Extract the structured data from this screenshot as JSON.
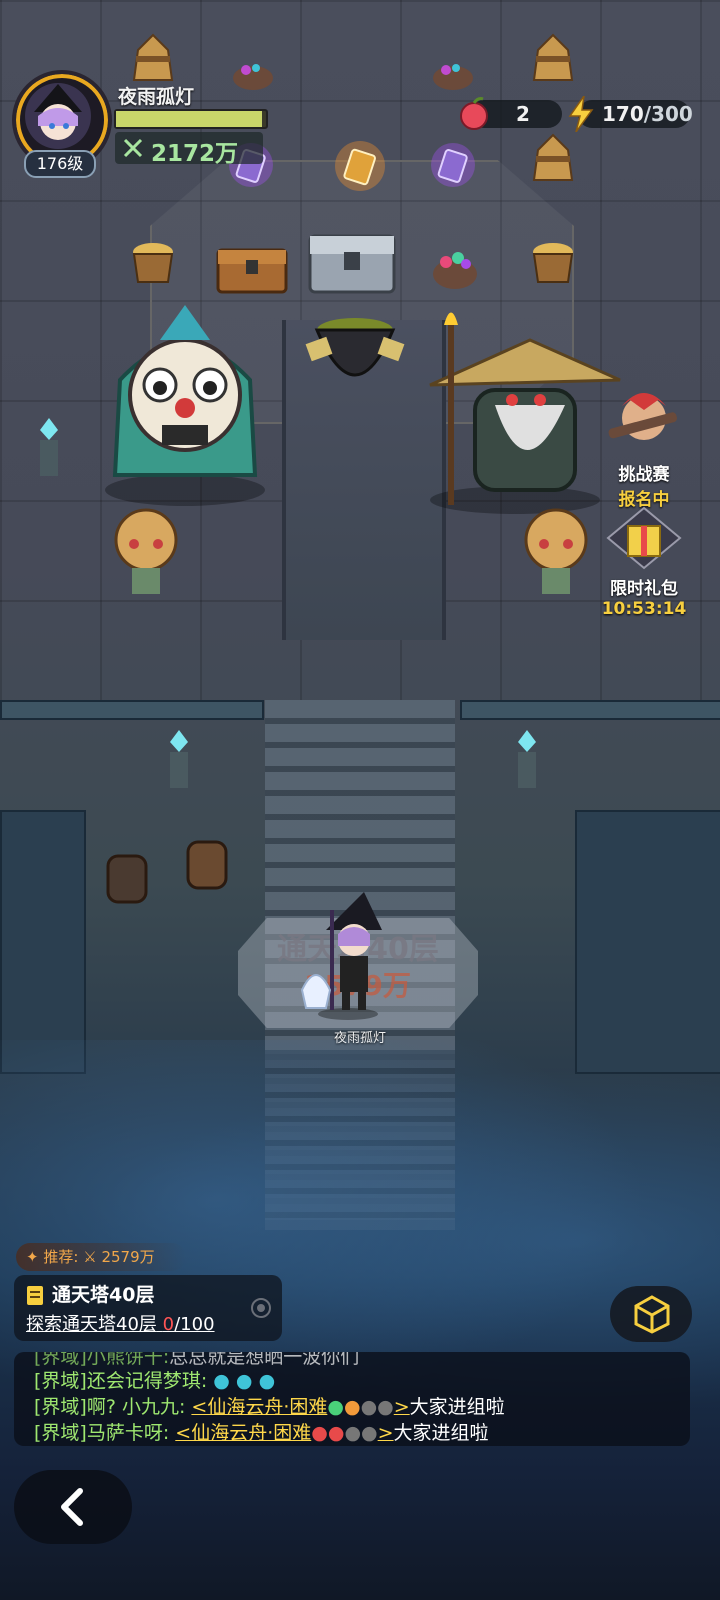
{
  "player": {
    "name": "夜雨孤灯",
    "level": "176级",
    "power": "2172万",
    "xp_fraction": 0.97
  },
  "resources": {
    "apples": "2",
    "energy_current": "170",
    "energy_max": "/300"
  },
  "side_buttons": {
    "challenge": {
      "label": "挑战赛",
      "status": "报名中"
    },
    "gift": {
      "label": "限时礼包",
      "timer": "10:53:14"
    }
  },
  "floor_plate": {
    "title": "通天塔40层",
    "power": "2579万"
  },
  "character_label": "夜雨孤灯",
  "recommend": {
    "label": "推荐:",
    "power": "2579万"
  },
  "quest": {
    "title": "通天塔40层",
    "desc": "探索通天塔40层",
    "progress_current": "0",
    "progress_max": "/100"
  },
  "chat": [
    {
      "channel": "[界域]",
      "name": "小熊饼干:",
      "text": "总总就是想晒一波你们"
    },
    {
      "channel": "[界域]",
      "name": "还会记得梦琪:",
      "text": ""
    },
    {
      "channel": "[界域]",
      "name": "啊? 小九九:",
      "link": "<仙海云舟·困难",
      "link_end": ">",
      "text": "大家进组啦"
    },
    {
      "channel": "[界域]",
      "name": "马萨卡呀:",
      "link": "<仙海云舟·困难",
      "link_end": ">",
      "text": "大家进组啦"
    }
  ],
  "colors": {
    "accent_gold": "#f7cf3f",
    "chat_green": "#9fe870",
    "link_yellow": "#ffd84a",
    "progress_red": "#ff5555",
    "power_green": "#a8e6a0"
  }
}
